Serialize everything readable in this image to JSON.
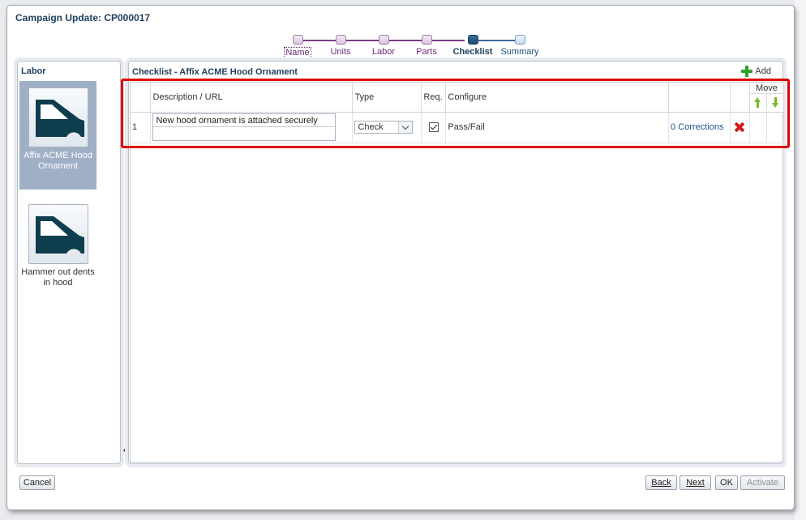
{
  "dialog": {
    "title": "Campaign Update: CP000017"
  },
  "train": [
    {
      "label": "Name"
    },
    {
      "label": "Units"
    },
    {
      "label": "Labor"
    },
    {
      "label": "Parts"
    },
    {
      "label": "Checklist"
    },
    {
      "label": "Summary"
    }
  ],
  "labor": {
    "heading": "Labor",
    "items": [
      {
        "label": "Affix ACME Hood Ornament"
      },
      {
        "label": "Hammer out dents in hood"
      }
    ]
  },
  "checklist": {
    "heading": "Checklist - Affix ACME Hood Ornament",
    "add_label": "Add",
    "columns": {
      "description": "Description / URL",
      "type": "Type",
      "req": "Req.",
      "configure": "Configure",
      "move": "Move"
    },
    "rows": [
      {
        "num": "1",
        "description": "New hood ornament is attached securely",
        "url": "",
        "type": "Check",
        "required": true,
        "configure": "Pass/Fail",
        "corrections": "0 Corrections"
      }
    ]
  },
  "footer": {
    "cancel": "Cancel",
    "back": "Back",
    "next": "Next",
    "ok": "OK",
    "activate": "Activate"
  }
}
